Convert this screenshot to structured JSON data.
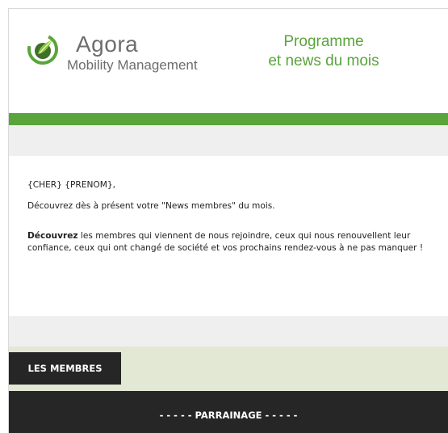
{
  "header": {
    "logo": {
      "icon": "agora-leaf-logo-icon",
      "name": "Agora",
      "subtitle": "Mobility Management"
    },
    "tagline_line1": "Programme",
    "tagline_line2": "et news du mois"
  },
  "colors": {
    "brand_green": "#5aa43c",
    "dark": "#262626",
    "light_gray": "#efefef",
    "olive_band": "#e3e8d4"
  },
  "message": {
    "greeting": "{CHER} {PRENOM},",
    "intro": "Découvrez dès à présent votre \"News membres\" du mois.",
    "body_bold": "Découvrez",
    "body_rest": " les membres qui viennent de nous rejoindre, ceux qui nous renouvellent leur confiance, ceux qui ont changé de société et vos prochains rendez-vous à ne pas manquer !"
  },
  "sections": {
    "members_label": "LES MEMBRES",
    "parrainage_label": "- - - - - PARRAINAGE - - - - -"
  }
}
